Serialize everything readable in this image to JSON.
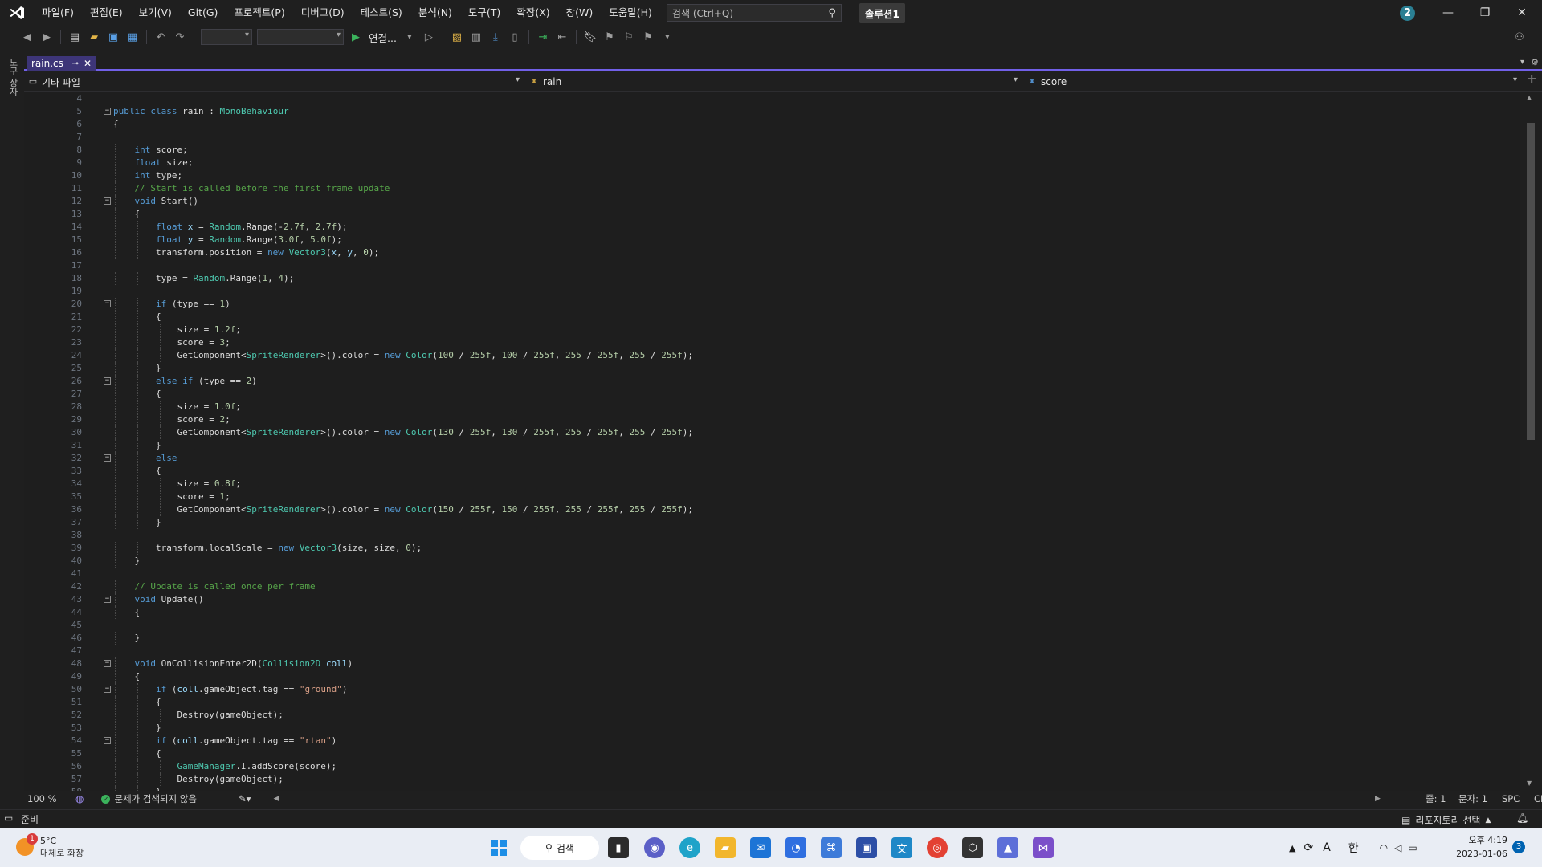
{
  "window": {
    "menu": [
      "파일(F)",
      "편집(E)",
      "보기(V)",
      "Git(G)",
      "프로젝트(P)",
      "디버그(D)",
      "테스트(S)",
      "분석(N)",
      "도구(T)",
      "확장(X)",
      "창(W)",
      "도움말(H)"
    ],
    "search_placeholder": "검색 (Ctrl+Q)",
    "solution_name": "솔루션1",
    "notification_count": "2"
  },
  "toolbar": {
    "run_label": "연결..."
  },
  "side_panel": {
    "tab_label": "도구 상자"
  },
  "document": {
    "tab_name": "rain.cs",
    "nav_project": "기타 파일",
    "nav_class": "rain",
    "nav_member": "score"
  },
  "code": {
    "first_line": 4,
    "lines": [
      {
        "t": ""
      },
      {
        "t": "public class rain : MonoBehaviour",
        "fold": true
      },
      {
        "t": "{"
      },
      {
        "t": ""
      },
      {
        "t": "    int score;"
      },
      {
        "t": "    float size;"
      },
      {
        "t": "    int type;"
      },
      {
        "t": "    // Start is called before the first frame update"
      },
      {
        "t": "    void Start()",
        "fold": true
      },
      {
        "t": "    {"
      },
      {
        "t": "        float x = Random.Range(-2.7f, 2.7f);"
      },
      {
        "t": "        float y = Random.Range(3.0f, 5.0f);"
      },
      {
        "t": "        transform.position = new Vector3(x, y, 0);"
      },
      {
        "t": ""
      },
      {
        "t": "        type = Random.Range(1, 4);"
      },
      {
        "t": ""
      },
      {
        "t": "        if (type == 1)",
        "fold": true
      },
      {
        "t": "        {"
      },
      {
        "t": "            size = 1.2f;"
      },
      {
        "t": "            score = 3;"
      },
      {
        "t": "            GetComponent<SpriteRenderer>().color = new Color(100 / 255f, 100 / 255f, 255 / 255f, 255 / 255f);"
      },
      {
        "t": "        }"
      },
      {
        "t": "        else if (type == 2)",
        "fold": true
      },
      {
        "t": "        {"
      },
      {
        "t": "            size = 1.0f;"
      },
      {
        "t": "            score = 2;"
      },
      {
        "t": "            GetComponent<SpriteRenderer>().color = new Color(130 / 255f, 130 / 255f, 255 / 255f, 255 / 255f);"
      },
      {
        "t": "        }"
      },
      {
        "t": "        else",
        "fold": true
      },
      {
        "t": "        {"
      },
      {
        "t": "            size = 0.8f;"
      },
      {
        "t": "            score = 1;"
      },
      {
        "t": "            GetComponent<SpriteRenderer>().color = new Color(150 / 255f, 150 / 255f, 255 / 255f, 255 / 255f);"
      },
      {
        "t": "        }"
      },
      {
        "t": ""
      },
      {
        "t": "        transform.localScale = new Vector3(size, size, 0);"
      },
      {
        "t": "    }"
      },
      {
        "t": ""
      },
      {
        "t": "    // Update is called once per frame"
      },
      {
        "t": "    void Update()",
        "fold": true
      },
      {
        "t": "    {"
      },
      {
        "t": ""
      },
      {
        "t": "    }"
      },
      {
        "t": ""
      },
      {
        "t": "    void OnCollisionEnter2D(Collision2D coll)",
        "fold": true
      },
      {
        "t": "    {"
      },
      {
        "t": "        if (coll.gameObject.tag == \"ground\")",
        "fold": true
      },
      {
        "t": "        {"
      },
      {
        "t": "            Destroy(gameObject);"
      },
      {
        "t": "        }"
      },
      {
        "t": "        if (coll.gameObject.tag == \"rtan\")",
        "fold": true
      },
      {
        "t": "        {"
      },
      {
        "t": "            GameManager.I.addScore(score);"
      },
      {
        "t": "            Destroy(gameObject);"
      },
      {
        "t": "        }"
      }
    ]
  },
  "editor_status": {
    "zoom": "100 %",
    "issues": "문제가 검색되지 않음",
    "line": "줄: 1",
    "col": "문자: 1",
    "spacing": "SPC",
    "eol": "CRLF"
  },
  "statusbar": {
    "ready": "준비",
    "repo": "리포지토리 선택"
  },
  "taskbar": {
    "weather_badge": "1",
    "weather_temp": "5°C",
    "weather_desc": "대체로 화창",
    "search_label": "검색",
    "ime_a": "A",
    "ime_lang": "한",
    "time": "오후 4:19",
    "date": "2023-01-06",
    "tray_badge": "3"
  },
  "colors": {
    "accent": "#7160e8",
    "tab_active": "#3d3578",
    "keyword": "#569cd6",
    "type": "#4ec9b0",
    "comment": "#57a64a",
    "string": "#d69d85"
  }
}
